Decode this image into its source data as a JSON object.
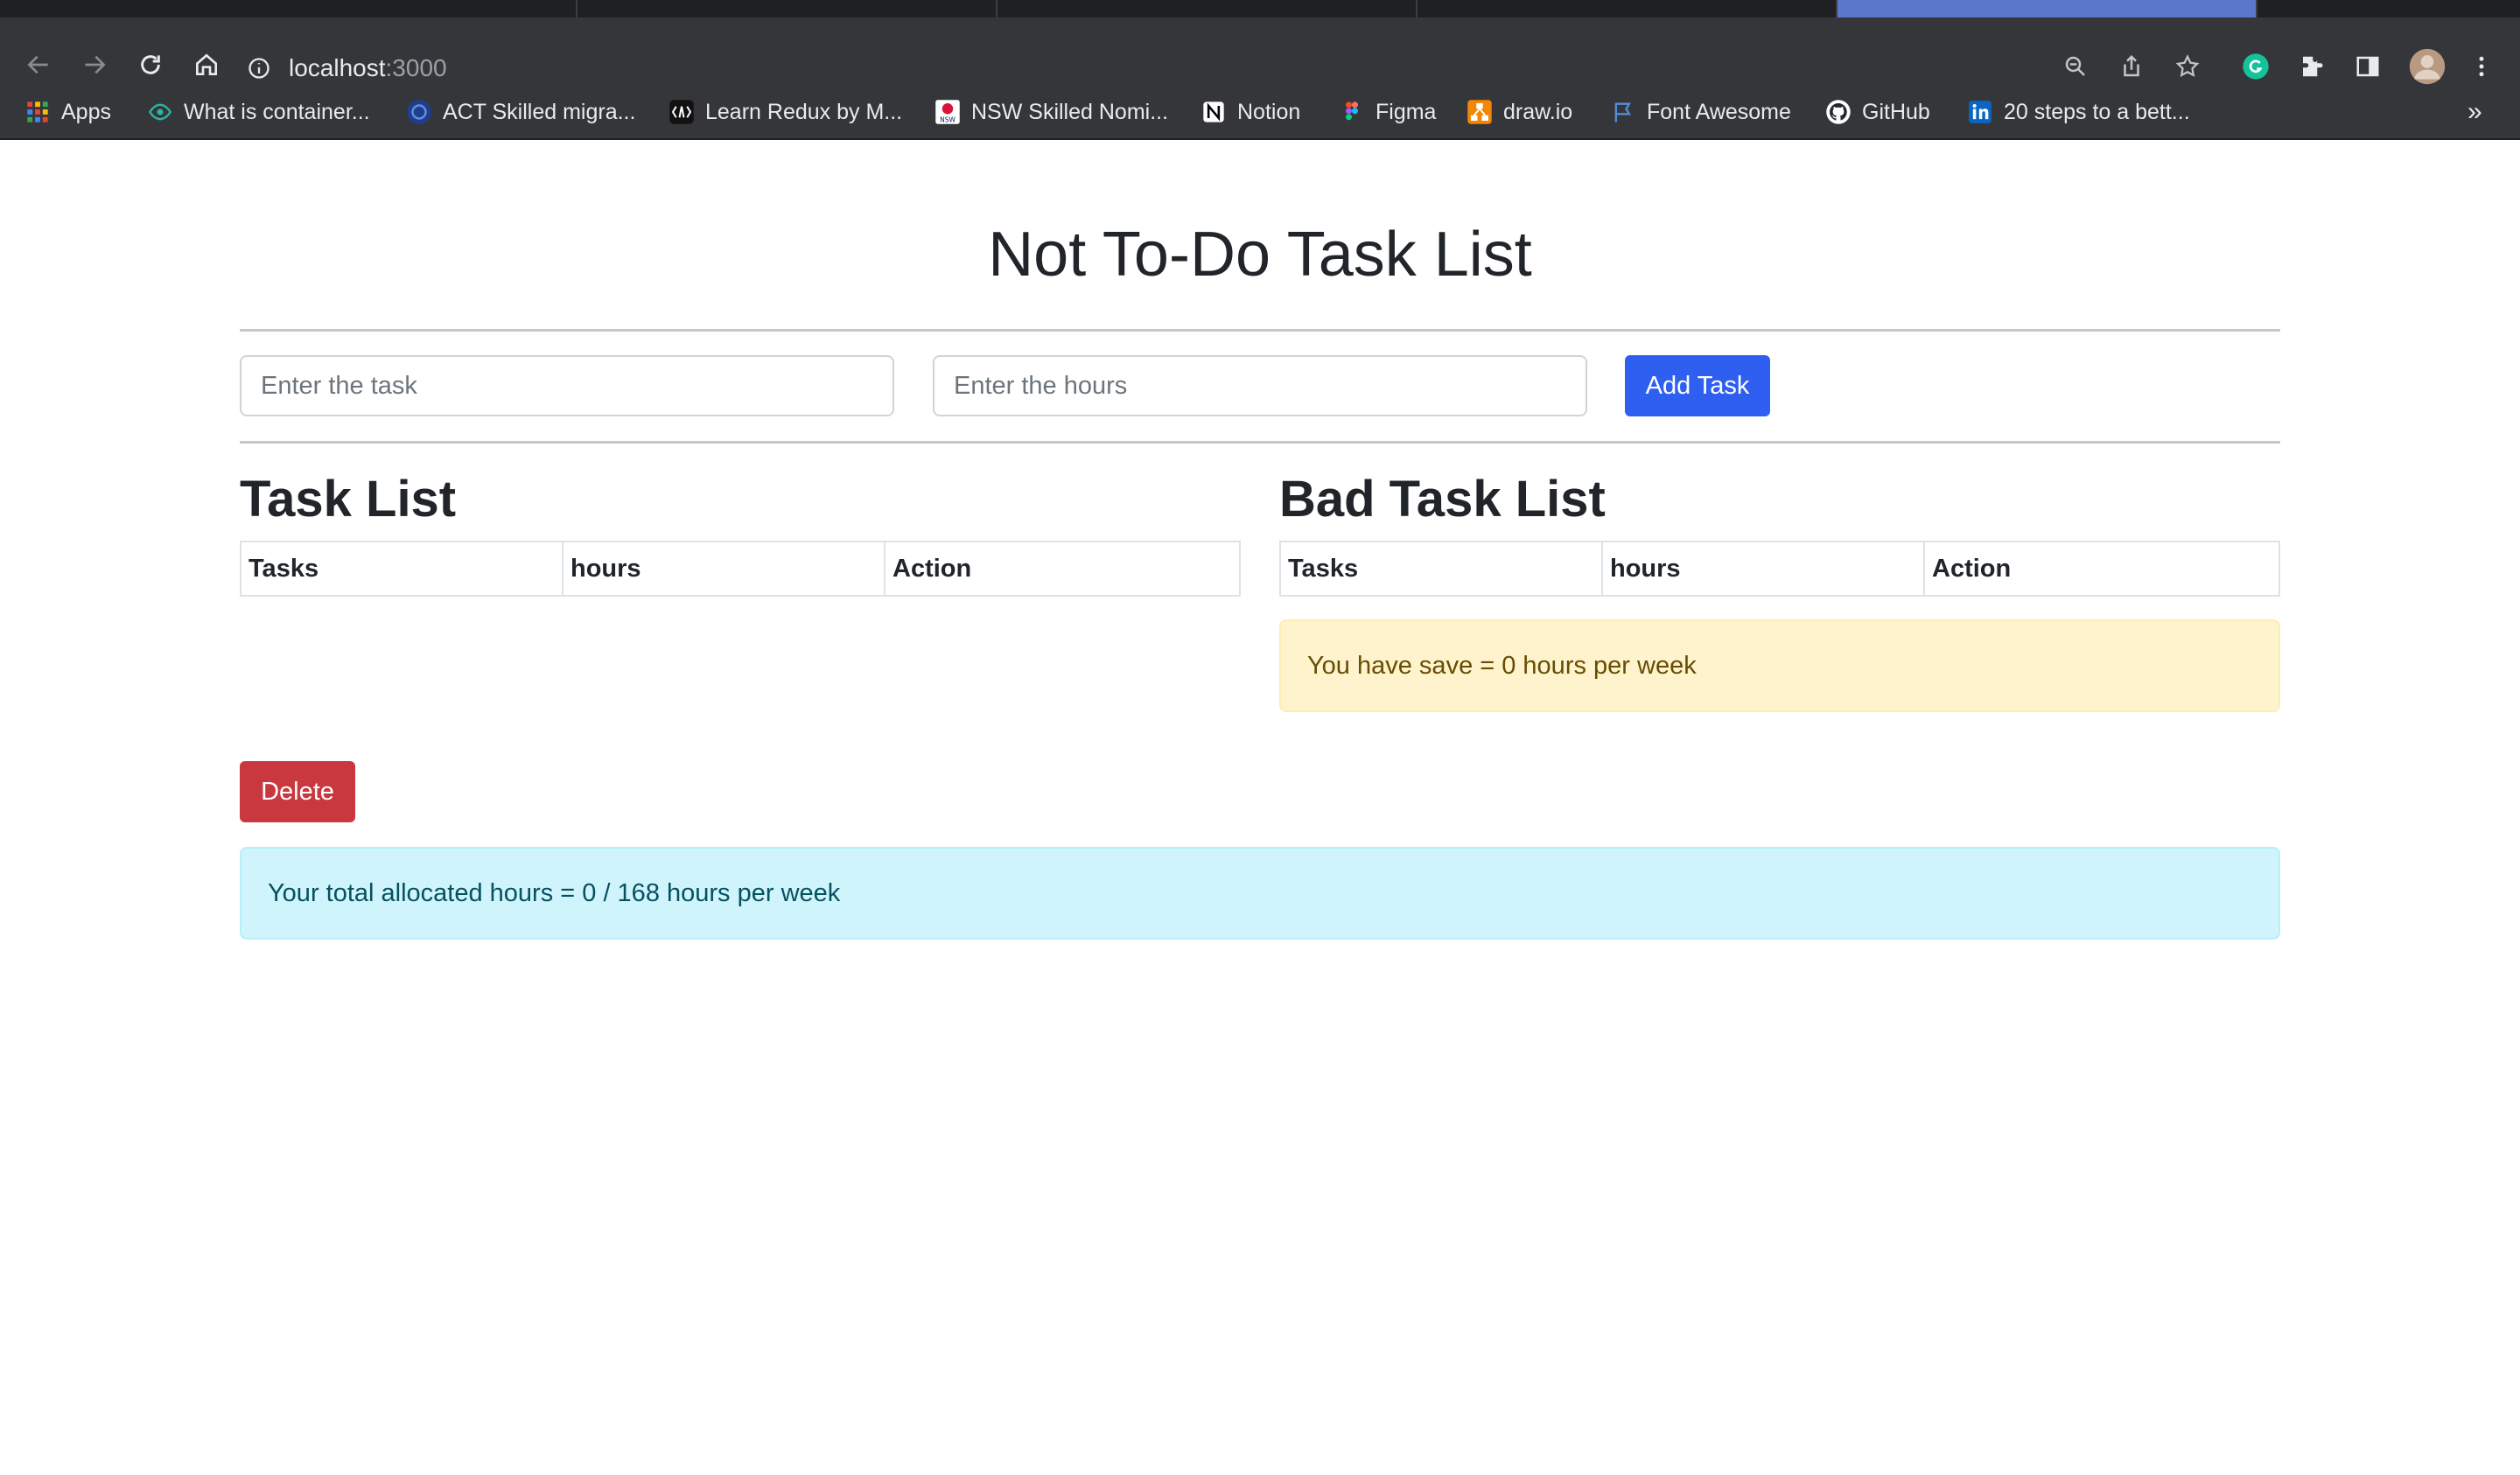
{
  "browser": {
    "url_host": "localhost",
    "url_port": ":3000",
    "bookmarks": [
      {
        "label": "Apps",
        "icon": "apps-grid-icon"
      },
      {
        "label": "What is container...",
        "icon": "eye-icon"
      },
      {
        "label": "ACT Skilled migra...",
        "icon": "act-gov-icon"
      },
      {
        "label": "Learn Redux by M...",
        "icon": "redux-icon"
      },
      {
        "label": "NSW Skilled Nomi...",
        "icon": "nsw-gov-icon"
      },
      {
        "label": "Notion",
        "icon": "notion-icon"
      },
      {
        "label": "Figma",
        "icon": "figma-icon"
      },
      {
        "label": "draw.io",
        "icon": "drawio-icon"
      },
      {
        "label": "Font Awesome",
        "icon": "flag-icon"
      },
      {
        "label": "GitHub",
        "icon": "github-icon"
      },
      {
        "label": "20 steps to a bett...",
        "icon": "linkedin-icon"
      }
    ],
    "overflow_label": "»"
  },
  "app": {
    "title": "Not To-Do Task List",
    "task_input": {
      "placeholder": "Enter the task",
      "value": ""
    },
    "hours_input": {
      "placeholder": "Enter the hours",
      "value": ""
    },
    "add_button": "Add Task",
    "task_list": {
      "heading": "Task List",
      "columns": [
        "Tasks",
        "hours",
        "Action"
      ],
      "rows": []
    },
    "bad_task_list": {
      "heading": "Bad Task List",
      "columns": [
        "Tasks",
        "hours",
        "Action"
      ],
      "rows": []
    },
    "saved_message": "You have save = 0 hours per week",
    "delete_button": "Delete",
    "total_message": "Your total allocated hours = 0 / 168 hours per week"
  },
  "colors": {
    "primary": "#2f5ff0",
    "danger": "#c9383e",
    "warning_bg": "#fff3cd",
    "info_bg": "#cff4fc"
  }
}
